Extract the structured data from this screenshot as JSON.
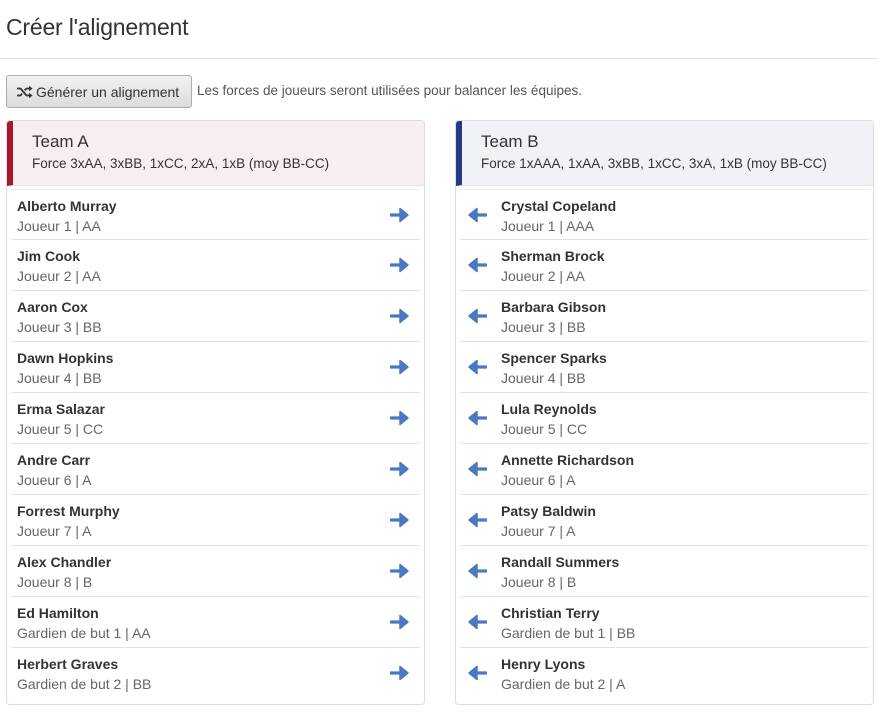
{
  "page": {
    "title": "Créer l'alignement"
  },
  "toolbar": {
    "generate_label": "Générer un alignement",
    "help_text": "Les forces de joueurs seront utilisées pour balancer les équipes."
  },
  "colors": {
    "team_a_accent": "#a4192c",
    "team_b_accent": "#243b7f",
    "arrow": "#4a78c2"
  },
  "icons": {
    "generate": "shuffle-icon",
    "move_right": "arrow-right-icon",
    "move_left": "arrow-left-icon"
  },
  "team_a": {
    "name": "Team A",
    "force": "Force 3xAA, 3xBB, 1xCC, 2xA, 1xB (moy BB-CC)",
    "players": [
      {
        "name": "Alberto Murray",
        "detail": "Joueur 1 | AA"
      },
      {
        "name": "Jim Cook",
        "detail": "Joueur 2 | AA"
      },
      {
        "name": "Aaron Cox",
        "detail": "Joueur 3 | BB"
      },
      {
        "name": "Dawn Hopkins",
        "detail": "Joueur 4 | BB"
      },
      {
        "name": "Erma Salazar",
        "detail": "Joueur 5 | CC"
      },
      {
        "name": "Andre Carr",
        "detail": "Joueur 6 | A"
      },
      {
        "name": "Forrest Murphy",
        "detail": "Joueur 7 | A"
      },
      {
        "name": "Alex Chandler",
        "detail": "Joueur 8 | B"
      },
      {
        "name": "Ed Hamilton",
        "detail": "Gardien de but 1 | AA"
      },
      {
        "name": "Herbert Graves",
        "detail": "Gardien de but 2 | BB"
      }
    ]
  },
  "team_b": {
    "name": "Team B",
    "force": "Force 1xAAA, 1xAA, 3xBB, 1xCC, 3xA, 1xB (moy BB-CC)",
    "players": [
      {
        "name": "Crystal Copeland",
        "detail": "Joueur 1 | AAA"
      },
      {
        "name": "Sherman Brock",
        "detail": "Joueur 2 | AA"
      },
      {
        "name": "Barbara Gibson",
        "detail": "Joueur 3 | BB"
      },
      {
        "name": "Spencer Sparks",
        "detail": "Joueur 4 | BB"
      },
      {
        "name": "Lula Reynolds",
        "detail": "Joueur 5 | CC"
      },
      {
        "name": "Annette Richardson",
        "detail": "Joueur 6 | A"
      },
      {
        "name": "Patsy Baldwin",
        "detail": "Joueur 7 | A"
      },
      {
        "name": "Randall Summers",
        "detail": "Joueur 8 | B"
      },
      {
        "name": "Christian Terry",
        "detail": "Gardien de but 1 | BB"
      },
      {
        "name": "Henry Lyons",
        "detail": "Gardien de but 2 | A"
      }
    ]
  }
}
